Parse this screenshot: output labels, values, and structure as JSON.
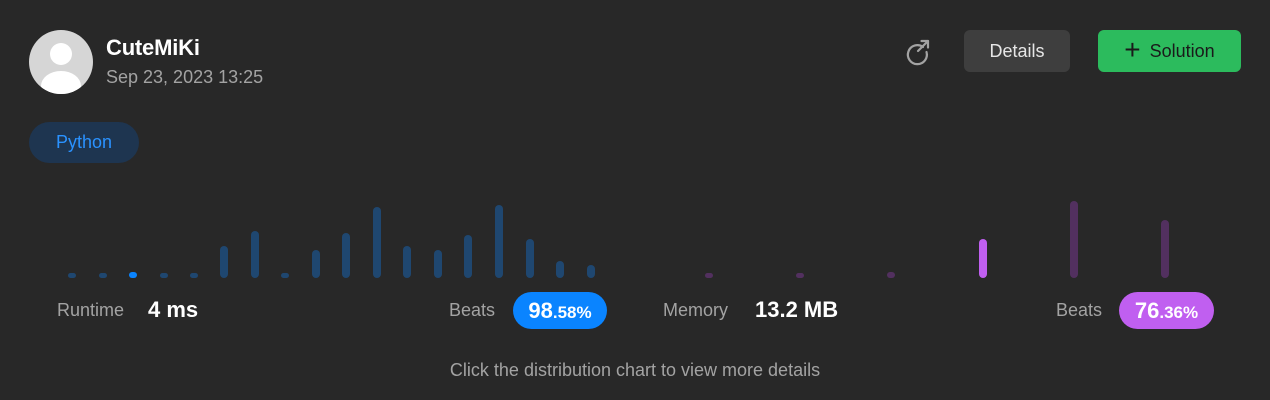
{
  "submission": {
    "username": "CuteMiKi",
    "timestamp": "Sep 23, 2023 13:25",
    "language": "Python"
  },
  "actions": {
    "share_icon": "share-arrow-icon",
    "details_label": "Details",
    "solution_label": "Solution",
    "solution_icon": "plus-icon"
  },
  "runtime": {
    "label": "Runtime",
    "value": "4 ms",
    "beats_label": "Beats",
    "beats_int": "98",
    "beats_dec": ".58%",
    "beats_percent": 98.58,
    "color": "#0a84ff",
    "dim_color": "#1f4770"
  },
  "memory": {
    "label": "Memory",
    "value": "13.2 MB",
    "beats_label": "Beats",
    "beats_int": "76",
    "beats_dec": ".36%",
    "beats_percent": 76.36,
    "color": "#c05ff0",
    "dim_color": "#52305f"
  },
  "hint": "Click the distribution chart to view more details",
  "chart_data": [
    {
      "type": "bar",
      "name": "runtime-distribution",
      "values": [
        2,
        2,
        3,
        2,
        2,
        15,
        22,
        2,
        13,
        21,
        33,
        15,
        13,
        20,
        34,
        18,
        8,
        6
      ],
      "highlight_index": 2,
      "ylim": [
        0,
        40
      ]
    },
    {
      "type": "bar",
      "name": "memory-distribution",
      "values": [
        2,
        2,
        3,
        18,
        36,
        27
      ],
      "highlight_index": 3,
      "ylim": [
        0,
        40
      ]
    }
  ]
}
